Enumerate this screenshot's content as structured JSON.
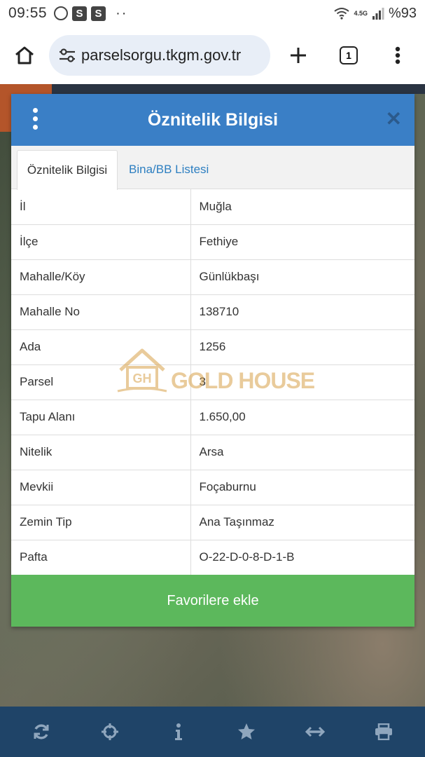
{
  "status_bar": {
    "time": "09:55",
    "badge_1": "S",
    "badge_2": "S",
    "dots": "··",
    "network": "4.5G",
    "battery": "%93"
  },
  "browser": {
    "url": "parselsorgu.tkgm.gov.tr",
    "tab_count": "1"
  },
  "modal": {
    "title": "Öznitelik Bilgisi",
    "close_label": "✕",
    "tabs": [
      {
        "label": "Öznitelik Bilgisi",
        "active": true
      },
      {
        "label": "Bina/BB Listesi",
        "active": false
      }
    ],
    "rows": [
      {
        "label": "İl",
        "value": "Muğla"
      },
      {
        "label": "İlçe",
        "value": "Fethiye"
      },
      {
        "label": "Mahalle/Köy",
        "value": "Günlükbaşı"
      },
      {
        "label": "Mahalle No",
        "value": "138710"
      },
      {
        "label": "Ada",
        "value": "1256"
      },
      {
        "label": "Parsel",
        "value": "3"
      },
      {
        "label": "Tapu Alanı",
        "value": "1.650,00"
      },
      {
        "label": "Nitelik",
        "value": "Arsa"
      },
      {
        "label": "Mevkii",
        "value": "Foçaburnu"
      },
      {
        "label": "Zemin Tip",
        "value": "Ana Taşınmaz"
      },
      {
        "label": "Pafta",
        "value": "O-22-D-0-8-D-1-B"
      }
    ],
    "favorite_button": "Favorilere ekle"
  },
  "watermark": {
    "logo_letters": "GH",
    "text": "GOLD HOUSE"
  },
  "toolbar_icons": [
    "refresh-icon",
    "crosshair-icon",
    "info-icon",
    "star-icon",
    "measure-icon",
    "print-icon"
  ],
  "colors": {
    "header_blue": "#3a7fc6",
    "link_blue": "#2d7fc1",
    "button_green": "#5cb85c",
    "toolbar_navy": "#1f4468",
    "toolbar_icon": "#8fa6bd"
  }
}
